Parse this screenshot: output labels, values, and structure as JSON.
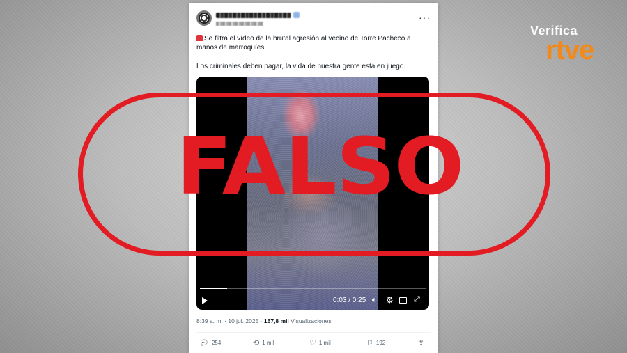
{
  "tweet": {
    "more_label": "···",
    "text_line1": "Se filtra el vídeo de la brutal agresión al vecino de Torre Pacheco a manos de marroquíes.",
    "text_line2": "Los criminales deben pagar, la vida de nuestra gente está en juego.",
    "siren_icon": "siren-icon",
    "timestamp": "8:39 a. m. · 10 jul. 2025 ·",
    "views_count": "167,8 mil",
    "views_label": "Visualizaciones"
  },
  "video": {
    "time": "0:03 / 0:25",
    "progress": 0.12
  },
  "actions": {
    "replies": "254",
    "reposts": "1 mil",
    "likes": "1 mil",
    "bookmarks": "192"
  },
  "stamp": {
    "label": "FALSO",
    "color": "#e31b23"
  },
  "logo": {
    "verifica": "Verifica",
    "rtve": "rtve",
    "accent": "#f08a1c"
  }
}
